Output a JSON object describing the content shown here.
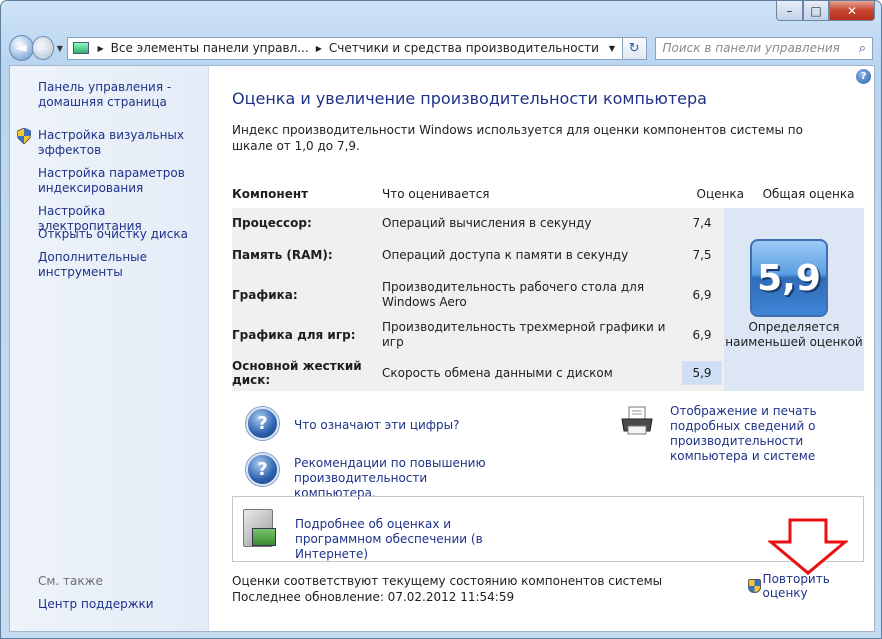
{
  "window": {
    "minimize": "–",
    "maximize": "□",
    "close": "✕"
  },
  "navbar": {
    "back_arrow": "◄",
    "forward_arrow": "►",
    "dropdown_arrow": "▼",
    "breadcrumb_sep": "▶",
    "breadcrumbs": [
      "Все элементы панели управл...",
      "Счетчики и средства производительности"
    ],
    "refresh_glyph": "↻",
    "search_placeholder": "Поиск в панели управления",
    "search_glyph": "⌕"
  },
  "sidebar": {
    "home_link": "Панель управления - домашняя страница",
    "items": [
      "Настройка визуальных эффектов",
      "Настройка параметров индексирования",
      "Настройка электропитания",
      "Открыть очистку диска",
      "Дополнительные инструменты"
    ],
    "see_also_label": "См. также",
    "support_link": "Центр поддержки"
  },
  "main": {
    "help_glyph": "?",
    "title": "Оценка и увеличение производительности компьютера",
    "intro": "Индекс производительности Windows используется для оценки компонентов системы по шкале от 1,0 до 7,9.",
    "table": {
      "headers": {
        "component": "Компонент",
        "rated": "Что оценивается",
        "score": "Оценка",
        "base": "Общая оценка"
      },
      "rows": [
        {
          "component": "Процессор:",
          "desc": "Операций вычисления в секунду",
          "score": "7,4"
        },
        {
          "component": "Память (RAM):",
          "desc": "Операций доступа к памяти в секунду",
          "score": "7,5"
        },
        {
          "component": "Графика:",
          "desc": "Производительность рабочего стола для Windows Aero",
          "score": "6,9"
        },
        {
          "component": "Графика для игр:",
          "desc": "Производительность трехмерной графики и игр",
          "score": "6,9"
        },
        {
          "component": "Основной жесткий диск:",
          "desc": "Скорость обмена данными с диском",
          "score": "5,9"
        }
      ],
      "base_score": "5,9",
      "base_note": "Определяется наименьшей оценкой"
    },
    "links": {
      "what_numbers": "Что означают эти цифры?",
      "tips": "Рекомендации по повышению производительности компьютера.",
      "print_details": "Отображение и печать подробных сведений о производительности компьютера и системе",
      "learn_more": "Подробнее об оценках и программном обеспечении (в Интернете)",
      "rerun": "Повторить оценку"
    },
    "status": "Оценки соответствуют текущему состоянию компонентов системы",
    "last_update": "Последнее обновление: 07.02.2012 11:54:59"
  }
}
